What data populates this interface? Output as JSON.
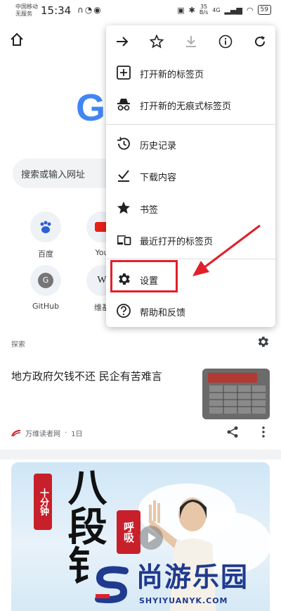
{
  "status_bar": {
    "carrier_line1": "中国移动",
    "carrier_line2": "无服务",
    "time": "15:34",
    "speed_value": "35",
    "speed_unit": "B/s",
    "network": "4G",
    "battery": "59"
  },
  "browser": {
    "search_placeholder": "搜索或输入网址"
  },
  "shortcuts": [
    {
      "label": "百度"
    },
    {
      "label": "You"
    },
    {
      "label": "GitHub",
      "letter": "G"
    },
    {
      "label": "维基"
    }
  ],
  "feed": {
    "section_label": "探索",
    "article": {
      "title": "地方政府欠钱不还 民企有苦难言",
      "source": "万维读者网",
      "age": "1日"
    }
  },
  "video": {
    "tag1": "十分钟",
    "tag2": "呼吸",
    "big_text": "八段钅"
  },
  "menu": {
    "items": [
      {
        "label": "打开新的标签页"
      },
      {
        "label": "打开新的无痕式标签页"
      },
      {
        "label": "历史记录"
      },
      {
        "label": "下载内容"
      },
      {
        "label": "书签"
      },
      {
        "label": "最近打开的标签页"
      },
      {
        "label": "设置"
      },
      {
        "label": "帮助和反馈"
      }
    ]
  },
  "watermark": {
    "cn": "尚游乐园",
    "en": "SHYIYUANYK.COM"
  },
  "colors": {
    "google_blue": "#4285f4",
    "highlight_red": "#e0202a",
    "watermark_blue": "#1f3a8f"
  }
}
